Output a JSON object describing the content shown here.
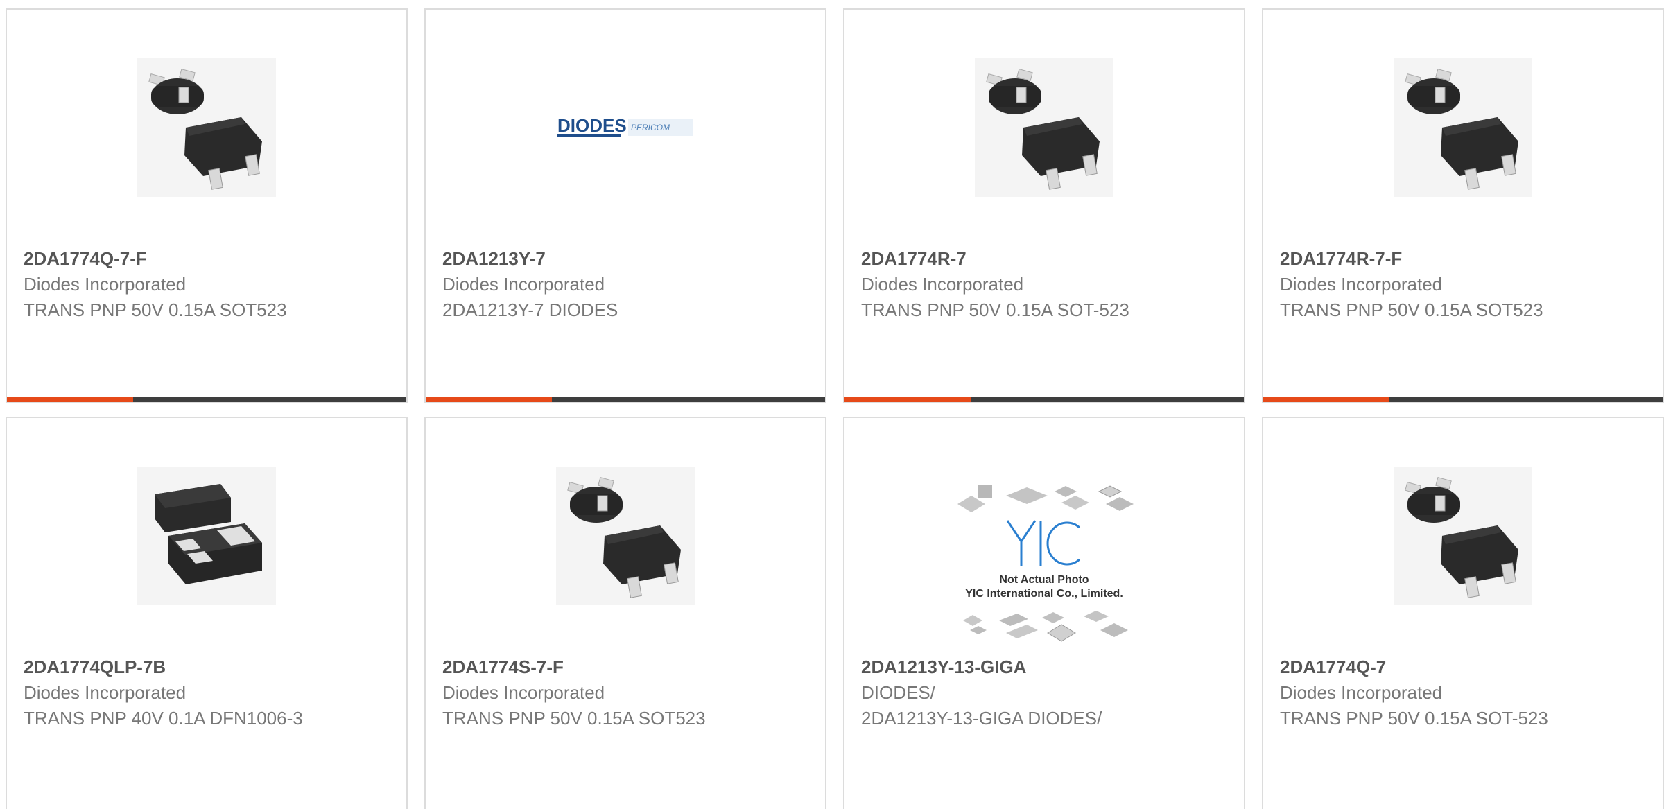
{
  "colors": {
    "accent": "#e64a19",
    "bar": "#3e3e3e",
    "border": "#dcdcdc",
    "part_number": "#555555",
    "text": "#777777"
  },
  "products": [
    {
      "part_number": "2DA1774Q-7-F",
      "manufacturer": "Diodes Incorporated",
      "description": "TRANS PNP 50V 0.15A SOT523",
      "image": "sot523-package-icon"
    },
    {
      "part_number": "2DA1213Y-7",
      "manufacturer": "Diodes Incorporated",
      "description": "2DA1213Y-7 DIODES",
      "image": "diodes-pericom-logo",
      "logo_text": "DIODES",
      "logo_subtext": "PERICOM"
    },
    {
      "part_number": "2DA1774R-7",
      "manufacturer": "Diodes Incorporated",
      "description": "TRANS PNP 50V 0.15A SOT-523",
      "image": "sot523-package-icon"
    },
    {
      "part_number": "2DA1774R-7-F",
      "manufacturer": "Diodes Incorporated",
      "description": "TRANS PNP 50V 0.15A SOT523",
      "image": "sot523-package-icon"
    },
    {
      "part_number": "2DA1774QLP-7B",
      "manufacturer": "Diodes Incorporated",
      "description": "TRANS PNP 40V 0.1A DFN1006-3",
      "image": "dfn1006-package-icon"
    },
    {
      "part_number": "2DA1774S-7-F",
      "manufacturer": "Diodes Incorporated",
      "description": "TRANS PNP 50V 0.15A SOT523",
      "image": "sot523-package-icon"
    },
    {
      "part_number": "2DA1213Y-13-GIGA",
      "manufacturer": "DIODES/",
      "description": "2DA1213Y-13-GIGA DIODES/",
      "image": "yic-placeholder-image",
      "placeholder_line1": "Not Actual Photo",
      "placeholder_line2": "YIC International Co., Limited."
    },
    {
      "part_number": "2DA1774Q-7",
      "manufacturer": "Diodes Incorporated",
      "description": "TRANS PNP 50V 0.15A SOT-523",
      "image": "sot523-package-icon"
    }
  ]
}
